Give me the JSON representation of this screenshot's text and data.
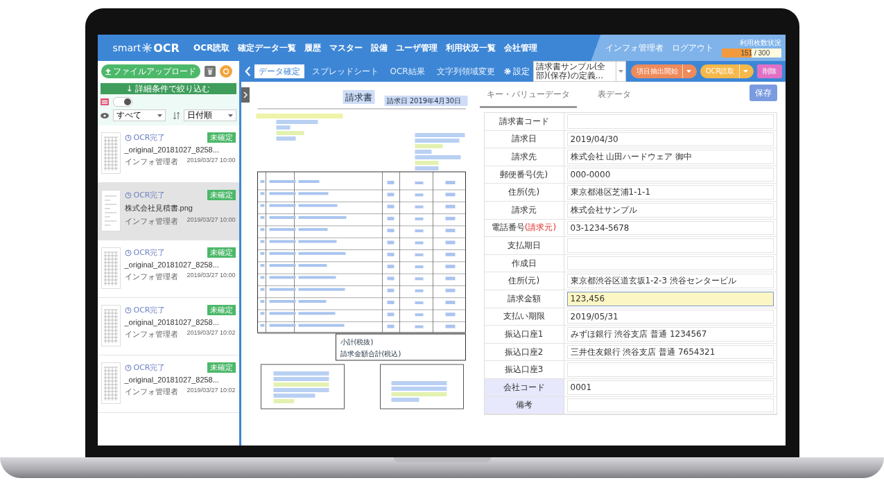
{
  "nav": {
    "logo": {
      "prefix": "smart",
      "name": "OCR"
    },
    "menu": [
      "OCR読取",
      "確定データ一覧",
      "履歴",
      "マスター",
      "設備",
      "ユーザ管理",
      "利用状況一覧",
      "会社管理"
    ],
    "user": "インフォ管理者",
    "logout": "ログアウト",
    "usage": {
      "caption": "利用枚数状況",
      "reading": "151 / 300",
      "level": 0.5
    }
  },
  "sidebar": {
    "upload_button": "ファイルアップロード",
    "filter_bar": "↓ 詳細条件で絞り込む",
    "toggle": {
      "on": true
    },
    "view_select": "すべて",
    "sort_select": "日付順",
    "items": [
      {
        "status": "OCR完了",
        "badge": "未確定",
        "file": "_original_20181027_8258...",
        "user": "インフォ管理者",
        "date": "2019/03/27 10:00",
        "selected": false,
        "kind": "table"
      },
      {
        "status": "OCR完了",
        "badge": "未確定",
        "file": "株式会社見積書.png",
        "user": "インフォ管理者",
        "date": "2019/03/27 10:00",
        "selected": true,
        "kind": "form"
      },
      {
        "status": "OCR完了",
        "badge": "未確定",
        "file": "_original_20181027_8258...",
        "user": "インフォ管理者",
        "date": "2019/03/27 10:00",
        "selected": false,
        "kind": "table"
      },
      {
        "status": "OCR完了",
        "badge": "未確定",
        "file": "_original_20181027_8258...",
        "user": "インフォ管理者",
        "date": "2019/03/27 10:02",
        "selected": false,
        "kind": "table"
      },
      {
        "status": "OCR完了",
        "badge": "未確定",
        "file": "_original_20181027_8258...",
        "user": "インフォ管理者",
        "date": "2019/03/27 10:02",
        "selected": false,
        "kind": "table"
      }
    ]
  },
  "toolbar": {
    "tabs": [
      {
        "label": "データ確定",
        "selected": true
      },
      {
        "label": "スプレッドシート",
        "selected": false
      },
      {
        "label": "OCR結果",
        "selected": false
      },
      {
        "label": "文字列領域変更",
        "selected": false
      }
    ],
    "settings": "設定",
    "template_select": "請求書サンプル(全部)(保存)の定義...",
    "extract_button": "項目抽出開始",
    "ocr_button": "OCR読取",
    "delete_button": "削除"
  },
  "document": {
    "title": "請求書",
    "date": "請求日 2019年4月30日",
    "subtotal_label": "小計(税抜)",
    "total_label": "請求金額合計(税込)"
  },
  "data_panel": {
    "tabs": [
      {
        "label": "キー・バリューデータ",
        "selected": true
      },
      {
        "label": "表データ",
        "selected": false
      }
    ],
    "save_button": "保存",
    "fields": [
      {
        "label": "請求書コード",
        "kind": "field",
        "selected": false
      },
      {
        "label": "請求日",
        "value": "2019/04/30",
        "kind": "field",
        "selected": false
      },
      {
        "label": "請求先",
        "value": "株式会社 山田ハードウェア 御中",
        "kind": "field",
        "selected": false
      },
      {
        "label": "郵便番号(先)",
        "value": "000-0000",
        "kind": "field",
        "selected": false
      },
      {
        "label": "住所(先)",
        "value": "東京都港区芝浦1-1-1",
        "kind": "field",
        "selected": false
      },
      {
        "label": "請求元",
        "value": "株式会社サンプル",
        "kind": "field",
        "selected": false
      },
      {
        "label": "電話番号",
        "note": "(請求元)",
        "value": "03-1234-5678",
        "kind": "field",
        "selected": false
      },
      {
        "label": "支払期日",
        "kind": "field",
        "selected": false
      },
      {
        "label": "作成日",
        "kind": "field",
        "selected": false
      },
      {
        "label": "住所(元)",
        "value": "東京都渋谷区道玄坂1-2-3 渋谷センタービル",
        "kind": "field",
        "selected": false
      },
      {
        "label": "請求金額",
        "value": "123,456",
        "kind": "field",
        "selected": true
      },
      {
        "label": "支払い期限",
        "value": "2019/05/31",
        "kind": "field",
        "selected": false
      },
      {
        "label": "振込口座1",
        "value": "みずほ銀行 渋谷支店 普通 1234567",
        "kind": "field",
        "selected": false
      },
      {
        "label": "振込口座2",
        "value": "三井住友銀行 渋谷支店 普通 7654321",
        "kind": "field",
        "selected": false
      },
      {
        "label": "振込口座3",
        "kind": "field",
        "selected": false
      },
      {
        "label": "会社コード",
        "value": "0001",
        "kind": "meta",
        "selected": false
      },
      {
        "label": "備考",
        "kind": "meta",
        "selected": false
      }
    ]
  }
}
